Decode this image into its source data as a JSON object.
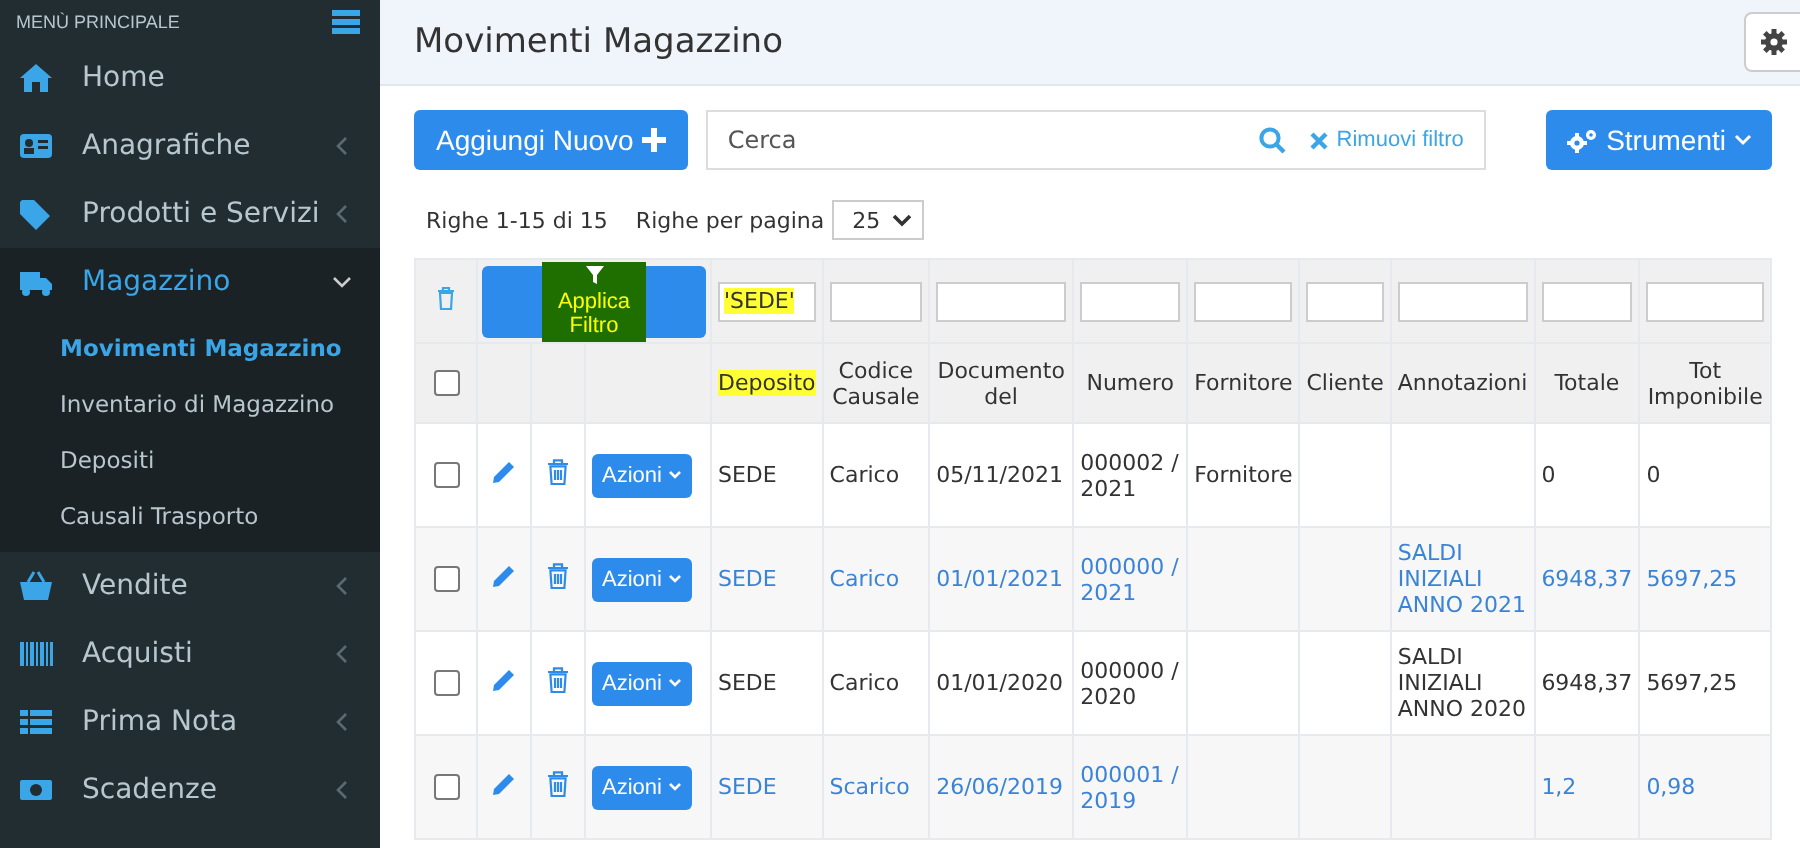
{
  "sidebar": {
    "title": "MENÙ PRINCIPALE",
    "items": [
      {
        "label": "Home",
        "kind": "link",
        "expanded": false
      },
      {
        "label": "Anagrafiche",
        "kind": "group",
        "expanded": false
      },
      {
        "label": "Prodotti e Servizi",
        "kind": "group",
        "expanded": false
      },
      {
        "label": "Magazzino",
        "kind": "group",
        "expanded": true,
        "children": [
          {
            "label": "Movimenti Magazzino",
            "selected": true
          },
          {
            "label": "Inventario di Magazzino",
            "selected": false
          },
          {
            "label": "Depositi",
            "selected": false
          },
          {
            "label": "Causali Trasporto",
            "selected": false
          }
        ]
      },
      {
        "label": "Vendite",
        "kind": "group",
        "expanded": false
      },
      {
        "label": "Acquisti",
        "kind": "group",
        "expanded": false
      },
      {
        "label": "Prima Nota",
        "kind": "group",
        "expanded": false
      },
      {
        "label": "Scadenze",
        "kind": "group",
        "expanded": false
      }
    ]
  },
  "page": {
    "title": "Movimenti Magazzino"
  },
  "toolbar": {
    "add_button": "Aggiungi Nuovo",
    "search": {
      "placeholder": "Cerca"
    },
    "clear_filter": "Rimuovi filtro",
    "tools_button": "Strumenti"
  },
  "pagination": {
    "info": "Righe 1-15 di 15",
    "per_page_label": "Righe per pagina",
    "per_page": "25"
  },
  "table": {
    "apply_filter": {
      "label": "Applica Filtro",
      "highlighted": true
    },
    "filters": [
      {
        "value": "'SEDE'",
        "highlighted": true
      },
      {
        "highlighted": false
      },
      {
        "highlighted": false
      },
      {
        "highlighted": false
      },
      {
        "highlighted": false
      },
      {
        "highlighted": false
      },
      {
        "highlighted": false
      },
      {
        "highlighted": false
      },
      {
        "highlighted": false
      }
    ],
    "select_all_checked": false,
    "columns": [
      {
        "label": "Deposito",
        "highlighted": true
      },
      {
        "label": "Codice Causale",
        "highlighted": false
      },
      {
        "label": "Documento del",
        "highlighted": false
      },
      {
        "label": "Numero",
        "highlighted": false
      },
      {
        "label": "Fornitore",
        "highlighted": false
      },
      {
        "label": "Cliente",
        "highlighted": false
      },
      {
        "label": "Annotazioni",
        "highlighted": false
      },
      {
        "label": "Totale",
        "highlighted": false
      },
      {
        "label": "Tot Imponibile",
        "highlighted": false
      }
    ],
    "rows": [
      {
        "linked": false,
        "checked": false,
        "action": "Azioni",
        "cells": [
          "SEDE",
          "Carico",
          "05/11/2021",
          "000002 / 2021",
          "Fornitore",
          null,
          null,
          "0",
          "0"
        ]
      },
      {
        "linked": true,
        "checked": false,
        "action": "Azioni",
        "cells": [
          "SEDE",
          "Carico",
          "01/01/2021",
          "000000 / 2021",
          null,
          null,
          "SALDI INIZIALI ANNO 2021",
          "6948,37",
          "5697,25"
        ]
      },
      {
        "linked": false,
        "checked": false,
        "action": "Azioni",
        "cells": [
          "SEDE",
          "Carico",
          "01/01/2020",
          "000000 / 2020",
          null,
          null,
          "SALDI INIZIALI ANNO 2020",
          "6948,37",
          "5697,25"
        ]
      },
      {
        "linked": true,
        "checked": false,
        "action": "Azioni",
        "cells": [
          "SEDE",
          "Scarico",
          "26/06/2019",
          "000001 / 2019",
          null,
          null,
          null,
          "1,2",
          "0,98"
        ]
      }
    ]
  }
}
